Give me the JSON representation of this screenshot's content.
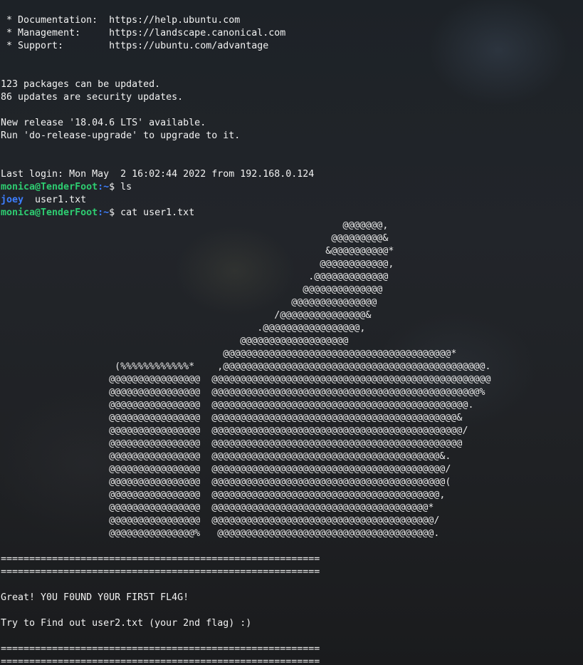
{
  "motd": {
    "doc_line": " * Documentation:  https://help.ubuntu.com",
    "mgmt_line": " * Management:     https://landscape.canonical.com",
    "support_line": " * Support:        https://ubuntu.com/advantage",
    "packages_line": "123 packages can be updated.",
    "security_line": "86 updates are security updates.",
    "release_line": "New release '18.04.6 LTS' available.",
    "upgrade_line": "Run 'do-release-upgrade' to upgrade to it.",
    "last_login": "Last login: Mon May  2 16:02:44 2022 from 192.168.0.124"
  },
  "prompt": {
    "user_host": "monica@TenderFoot",
    "path": ":~",
    "symbol": "$ "
  },
  "commands": {
    "cmd1": "ls",
    "cmd2": "cat user1.txt"
  },
  "ls_output": {
    "dir_name": "joey",
    "file_name": "  user1.txt"
  },
  "ascii_art": [
    "                                                            @@@@@@@,",
    "                                                          @@@@@@@@@&",
    "                                                         &@@@@@@@@@@*",
    "                                                        @@@@@@@@@@@@,",
    "                                                      .@@@@@@@@@@@@@",
    "                                                     @@@@@@@@@@@@@@",
    "                                                   @@@@@@@@@@@@@@@",
    "                                                /@@@@@@@@@@@@@@@&",
    "                                             .@@@@@@@@@@@@@@@@@,",
    "                                          @@@@@@@@@@@@@@@@@@@",
    "                                       @@@@@@@@@@@@@@@@@@@@@@@@@@@@@@@@@@@@@@@@*",
    "                    (%%%%%%%%%%%%*    ,@@@@@@@@@@@@@@@@@@@@@@@@@@@@@@@@@@@@@@@@@@@@@@.",
    "                   @@@@@@@@@@@@@@@@  @@@@@@@@@@@@@@@@@@@@@@@@@@@@@@@@@@@@@@@@@@@@@@@@@",
    "                   @@@@@@@@@@@@@@@@  @@@@@@@@@@@@@@@@@@@@@@@@@@@@@@@@@@@@@@@@@@@@@@@%",
    "                   @@@@@@@@@@@@@@@@  @@@@@@@@@@@@@@@@@@@@@@@@@@@@@@@@@@@@@@@@@@@@@.",
    "                   @@@@@@@@@@@@@@@@  @@@@@@@@@@@@@@@@@@@@@@@@@@@@@@@@@@@@@@@@@@@&",
    "                   @@@@@@@@@@@@@@@@  @@@@@@@@@@@@@@@@@@@@@@@@@@@@@@@@@@@@@@@@@@@@/",
    "                   @@@@@@@@@@@@@@@@  @@@@@@@@@@@@@@@@@@@@@@@@@@@@@@@@@@@@@@@@@@@@",
    "                   @@@@@@@@@@@@@@@@  @@@@@@@@@@@@@@@@@@@@@@@@@@@@@@@@@@@@@@@@&.",
    "                   @@@@@@@@@@@@@@@@  @@@@@@@@@@@@@@@@@@@@@@@@@@@@@@@@@@@@@@@@@/",
    "                   @@@@@@@@@@@@@@@@  @@@@@@@@@@@@@@@@@@@@@@@@@@@@@@@@@@@@@@@@@(",
    "                   @@@@@@@@@@@@@@@@  @@@@@@@@@@@@@@@@@@@@@@@@@@@@@@@@@@@@@@@@,",
    "                   @@@@@@@@@@@@@@@@  @@@@@@@@@@@@@@@@@@@@@@@@@@@@@@@@@@@@@@*",
    "                   @@@@@@@@@@@@@@@@  @@@@@@@@@@@@@@@@@@@@@@@@@@@@@@@@@@@@@@@/",
    "                   @@@@@@@@@@@@@@@%   @@@@@@@@@@@@@@@@@@@@@@@@@@@@@@@@@@@@@@."
  ],
  "separator": "========================================================",
  "flag_message": "Great! Y0U F0UND Y0UR FIR5T FL4G!",
  "hint_message": "Try to Find out user2.txt (your 2nd flag) :)"
}
